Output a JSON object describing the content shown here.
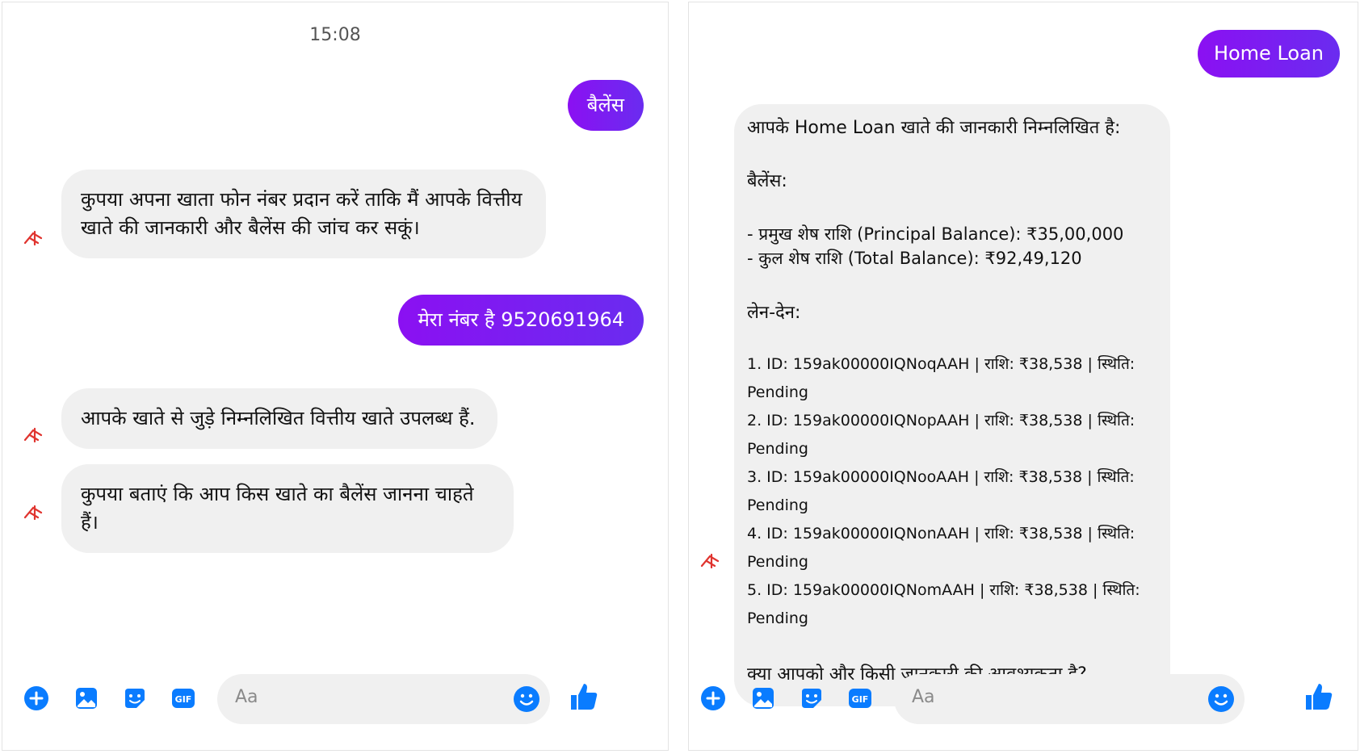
{
  "left": {
    "timestamp": "15:08",
    "messages": [
      {
        "side": "out",
        "text": "बैलेंस"
      },
      {
        "side": "in",
        "text": "कुपया अपना खाता फोन नंबर प्रदान करें ताकि मैं आपके वित्तीय\nखाते की जानकारी और बैलेंस की जांच कर सकूं।"
      },
      {
        "side": "out",
        "text": "मेरा नंबर है 9520691964"
      },
      {
        "side": "in",
        "text": "आपके खाते से जुड़े निम्नलिखित वित्तीय खाते उपलब्ध हैं."
      },
      {
        "side": "in",
        "text": "कुपया बताएं कि आप किस खाते का बैलेंस जानना चाहते हैं।"
      }
    ],
    "composer": {
      "placeholder": "Aa"
    }
  },
  "right": {
    "messages": [
      {
        "side": "out",
        "text": "Home Loan"
      }
    ],
    "reply": {
      "intro": "आपके Home Loan खाते की जानकारी निम्नलिखित है:",
      "balance_heading": "बैलेंस:",
      "balances": [
        "- प्रमुख शेष राशि (Principal Balance): ₹35,00,000",
        "- कुल शेष राशि (Total Balance): ₹92,49,120"
      ],
      "txn_heading": "लेन-देन:",
      "transactions": [
        "1. ID: 159ak00000IQNoqAAH | राशि: ₹38,538 | स्थिति: Pending",
        "2. ID: 159ak00000IQNopAAH | राशि: ₹38,538 | स्थिति: Pending",
        "3. ID: 159ak00000IQNooAAH | राशि: ₹38,538 | स्थिति: Pending",
        "4. ID: 159ak00000IQNonAAH | राशि: ₹38,538 | स्थिति: Pending",
        "5. ID: 159ak00000IQNomAAH | राशि: ₹38,538 | स्थिति: Pending"
      ],
      "closing": "क्या आपको और किसी जानकारी की आवश्यकता है?"
    },
    "composer": {
      "placeholder": "Aa"
    }
  },
  "icons": {
    "add": "plus-icon",
    "image": "image-icon",
    "sticker": "sticker-icon",
    "gif": "gif-icon",
    "emoji": "emoji-icon",
    "like": "thumbs-up-icon",
    "bot": "bot-icon"
  },
  "colors": {
    "accent": "#0a7cff",
    "outgoing_start": "#8b10f2",
    "outgoing_end": "#6a2cf0",
    "incoming": "#f0f0f0",
    "bot": "#e0342f"
  },
  "labels": {
    "gif": "GIF"
  }
}
